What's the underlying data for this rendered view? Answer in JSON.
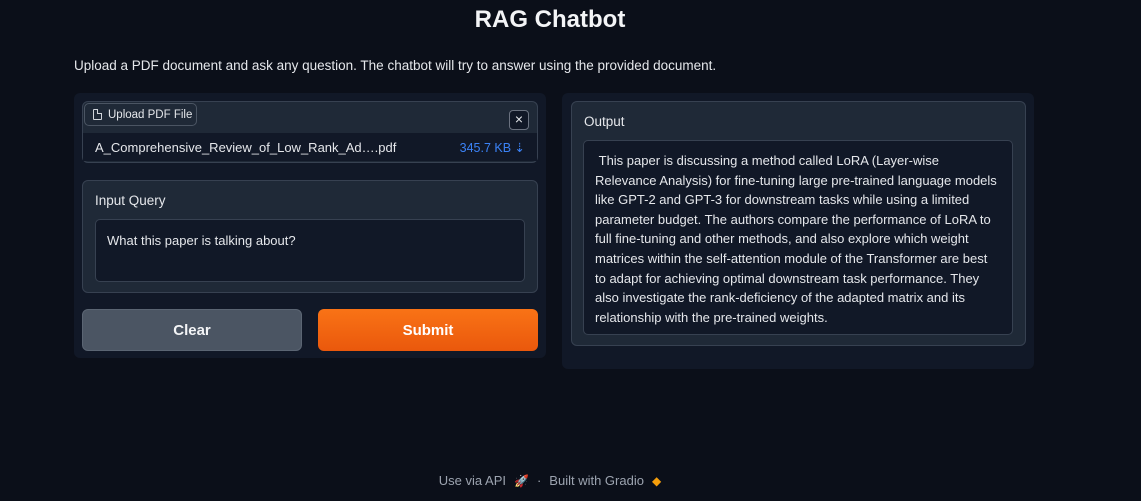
{
  "header": {
    "title": "RAG Chatbot",
    "subtitle": "Upload a PDF document and ask any question. The chatbot will try to answer using the provided document."
  },
  "upload": {
    "tab_label": "Upload PDF File",
    "close_symbol": "×",
    "file_name": "A_Comprehensive_Review_of_Low_Rank_Ad….pdf",
    "file_size": "345.7 KB ⇣"
  },
  "query": {
    "label": "Input Query",
    "value": "What this paper is talking about?"
  },
  "buttons": {
    "clear_label": "Clear",
    "submit_label": "Submit"
  },
  "output": {
    "label": "Output",
    "text": " This paper is discussing a method called LoRA (Layer-wise Relevance Analysis) for fine-tuning large pre-trained language models like GPT-2 and GPT-3 for downstream tasks while using a limited parameter budget. The authors compare the performance of LoRA to full fine-tuning and other methods, and also explore which weight matrices within the self-attention module of the Transformer are best to adapt for achieving optimal downstream task performance. They also investigate the rank-deficiency of the adapted matrix and its relationship with the pre-trained weights."
  },
  "footer": {
    "api_label": "Use via API",
    "separator": "·",
    "built_label": "Built with Gradio"
  },
  "colors": {
    "accent": "#f97316",
    "link": "#3b82f6",
    "background": "#0b0f19"
  }
}
